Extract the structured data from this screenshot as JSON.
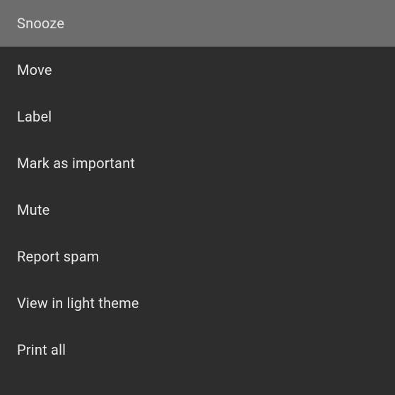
{
  "menu": {
    "items": [
      {
        "label": "Snooze",
        "highlighted": true
      },
      {
        "label": "Move",
        "highlighted": false
      },
      {
        "label": "Label",
        "highlighted": false
      },
      {
        "label": "Mark as important",
        "highlighted": false
      },
      {
        "label": "Mute",
        "highlighted": false
      },
      {
        "label": "Report spam",
        "highlighted": false
      },
      {
        "label": "View in light theme",
        "highlighted": false
      },
      {
        "label": "Print all",
        "highlighted": false
      }
    ]
  }
}
